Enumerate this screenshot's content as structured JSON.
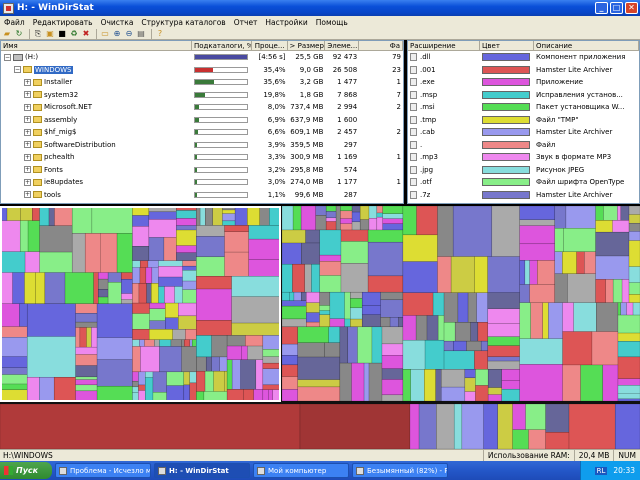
{
  "window": {
    "title": "H: - WinDirStat"
  },
  "menu": [
    "Файл",
    "Редактировать",
    "Очистка",
    "Структура каталогов",
    "Отчет",
    "Настройки",
    "Помощь"
  ],
  "tree": {
    "columns": [
      "Имя",
      "Подкаталоги, %",
      "Проце...",
      "> Размер",
      "Элеме...",
      "Фа"
    ],
    "rows": [
      {
        "name": "(H:)",
        "indent": 0,
        "kind": "drive",
        "sub_text": "",
        "pct": "[4:56 s]",
        "size": "25,5 GB",
        "items": "92 473",
        "files": "79",
        "bar": 1.0,
        "bar_color": "#4a4aa0"
      },
      {
        "name": "WINDOWS",
        "indent": 1,
        "kind": "folder",
        "sub_text": "",
        "pct": "35,4%",
        "size": "9,0 GB",
        "items": "26 508",
        "files": "23",
        "bar": 0.354,
        "bar_color": "#c83030",
        "selected": true
      },
      {
        "name": "Installer",
        "indent": 2,
        "kind": "folder",
        "pct": "35,6%",
        "size": "3,2 GB",
        "items": "1 477",
        "files": "1",
        "bar": 0.356,
        "bar_color": "#3a7a3a"
      },
      {
        "name": "system32",
        "indent": 2,
        "kind": "folder",
        "pct": "19,8%",
        "size": "1,8 GB",
        "items": "7 868",
        "files": "7",
        "bar": 0.198,
        "bar_color": "#3a7a3a"
      },
      {
        "name": "Microsoft.NET",
        "indent": 2,
        "kind": "folder",
        "pct": "8,0%",
        "size": "737,4 MB",
        "items": "2 994",
        "files": "2",
        "bar": 0.08,
        "bar_color": "#3a7a3a"
      },
      {
        "name": "assembly",
        "indent": 2,
        "kind": "folder",
        "pct": "6,9%",
        "size": "637,9 MB",
        "items": "1 600",
        "files": "",
        "bar": 0.069,
        "bar_color": "#3a7a3a"
      },
      {
        "name": "$hf_mig$",
        "indent": 2,
        "kind": "folder",
        "pct": "6,6%",
        "size": "609,1 MB",
        "items": "2 457",
        "files": "2",
        "bar": 0.066,
        "bar_color": "#3a7a3a"
      },
      {
        "name": "SoftwareDistribution",
        "indent": 2,
        "kind": "folder",
        "pct": "3,9%",
        "size": "359,5 MB",
        "items": "297",
        "files": "",
        "bar": 0.039,
        "bar_color": "#3a7a3a"
      },
      {
        "name": "pchealth",
        "indent": 2,
        "kind": "folder",
        "pct": "3,3%",
        "size": "300,9 MB",
        "items": "1 169",
        "files": "1",
        "bar": 0.033,
        "bar_color": "#3a7a3a"
      },
      {
        "name": "Fonts",
        "indent": 2,
        "kind": "folder",
        "pct": "3,2%",
        "size": "295,8 MB",
        "items": "574",
        "files": "",
        "bar": 0.032,
        "bar_color": "#3a7a3a"
      },
      {
        "name": "ie8updates",
        "indent": 2,
        "kind": "folder",
        "pct": "3,0%",
        "size": "274,0 MB",
        "items": "1 177",
        "files": "1",
        "bar": 0.03,
        "bar_color": "#3a7a3a"
      },
      {
        "name": "tools",
        "indent": 2,
        "kind": "folder",
        "pct": "1,1%",
        "size": "99,6 MB",
        "items": "287",
        "files": "",
        "bar": 0.011,
        "bar_color": "#3a7a3a"
      }
    ]
  },
  "extensions": {
    "columns": [
      "Расширение",
      "Цвет",
      "Описание"
    ],
    "rows": [
      {
        "ext": ".dll",
        "color": "#6666dd",
        "desc": "Компонент приложения"
      },
      {
        "ext": ".001",
        "color": "#dd5555",
        "desc": "Hamster Lite Archiver"
      },
      {
        "ext": ".exe",
        "color": "#dd55dd",
        "desc": "Приложение"
      },
      {
        "ext": ".msp",
        "color": "#44cccc",
        "desc": "Исправления установ..."
      },
      {
        "ext": ".msi",
        "color": "#55dd55",
        "desc": "Пакет установщика W..."
      },
      {
        "ext": ".tmp",
        "color": "#dddd33",
        "desc": "Файл \"TMP\""
      },
      {
        "ext": ".cab",
        "color": "#9999ee",
        "desc": "Hamster Lite Archiver"
      },
      {
        "ext": ".",
        "color": "#ee8888",
        "desc": "Файл"
      },
      {
        "ext": ".mp3",
        "color": "#ee88ee",
        "desc": "Звук в формате MP3"
      },
      {
        "ext": ".jpg",
        "color": "#88dddd",
        "desc": "Рисунок JPEG"
      },
      {
        "ext": ".otf",
        "color": "#88ee88",
        "desc": "Файл шрифта OpenType"
      },
      {
        "ext": ".7z",
        "color": "#7777cc",
        "desc": "Hamster Lite Archiver"
      }
    ]
  },
  "status": {
    "path": "H:\\WINDOWS",
    "ram_label": "Использование RAM:",
    "ram_value": "20,4 MB",
    "num": "NUM"
  },
  "taskbar": {
    "start_label": "Пуск",
    "tasks": [
      {
        "label": "Проблема - Исчезло мес...",
        "active": false
      },
      {
        "label": "H: - WinDirStat",
        "active": true
      },
      {
        "label": "Мой компьютер",
        "active": false
      },
      {
        "label": "Безымянный (82%) - Pa...",
        "active": false
      }
    ],
    "lang": "RL",
    "clock": "20:33"
  }
}
